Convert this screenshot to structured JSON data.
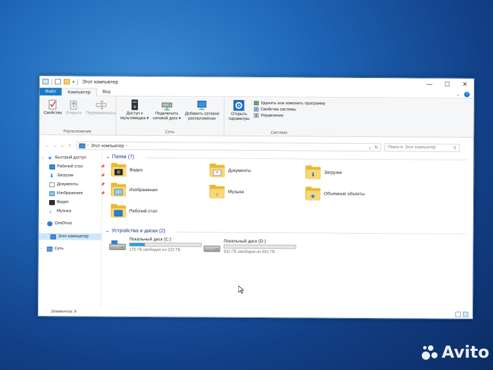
{
  "window": {
    "title": "Этот компьютер",
    "controls": {
      "minimize": "—",
      "maximize": "☐",
      "close": "✕"
    }
  },
  "ribbon": {
    "tabs": [
      "Файл",
      "Компьютер",
      "Вид"
    ],
    "groups": {
      "location": {
        "label": "Расположение",
        "buttons": [
          "Свойства",
          "Открыть",
          "Переименовать"
        ]
      },
      "network": {
        "label": "Сеть",
        "buttons": [
          "Доступ к\nмультимедиа ▾",
          "Подключить\nсетевой диск ▾",
          "Добавить сетевое\nрасположение"
        ]
      },
      "system": {
        "label": "Система",
        "open_settings": "Открыть\nпараметры",
        "items": [
          "Удалить или изменить программу",
          "Свойства системы",
          "Управление"
        ]
      }
    }
  },
  "address": {
    "path": "Этот компьютер",
    "search_placeholder": "Поиск в: Этот компьютер"
  },
  "navigation": {
    "items": [
      {
        "label": "Быстрый доступ",
        "icon": "star-icon"
      },
      {
        "label": "Рабочий стол",
        "icon": "desktop-icon",
        "pinned": true
      },
      {
        "label": "Загрузки",
        "icon": "download-icon",
        "pinned": true
      },
      {
        "label": "Документы",
        "icon": "documents-icon",
        "pinned": true
      },
      {
        "label": "Изображения",
        "icon": "pictures-icon",
        "pinned": true
      },
      {
        "label": "Видео",
        "icon": "video-icon"
      },
      {
        "label": "Музыка",
        "icon": "music-icon"
      },
      {
        "label": "OneDrive",
        "icon": "onedrive-icon"
      },
      {
        "label": "Этот компьютер",
        "icon": "computer-icon",
        "selected": true
      },
      {
        "label": "Сеть",
        "icon": "network-icon"
      }
    ]
  },
  "content": {
    "folders_header": "Папки (7)",
    "folders": [
      "Видео",
      "Документы",
      "Загрузки",
      "Изображения",
      "Музыка",
      "Объемные объекты",
      "Рабочий стол"
    ],
    "drives_header": "Устройства и диски (2)",
    "drives": [
      {
        "name": "Локальный диск (C:)",
        "free_text": "175 ГБ свободно из 222 ГБ",
        "used_fraction": 0.21,
        "system": true
      },
      {
        "name": "Локальный диск (D:)",
        "free_text": "931 ГБ свободно из 931 ГБ",
        "used_fraction": 0.0,
        "system": false
      }
    ]
  },
  "status": {
    "items_count": "Элементов: 9"
  },
  "colors": {
    "accent": "#1979ca",
    "selection": "#cce8ff",
    "header_text": "#1e3287",
    "drive_fill": "#26a0da"
  },
  "watermark": "Avito"
}
